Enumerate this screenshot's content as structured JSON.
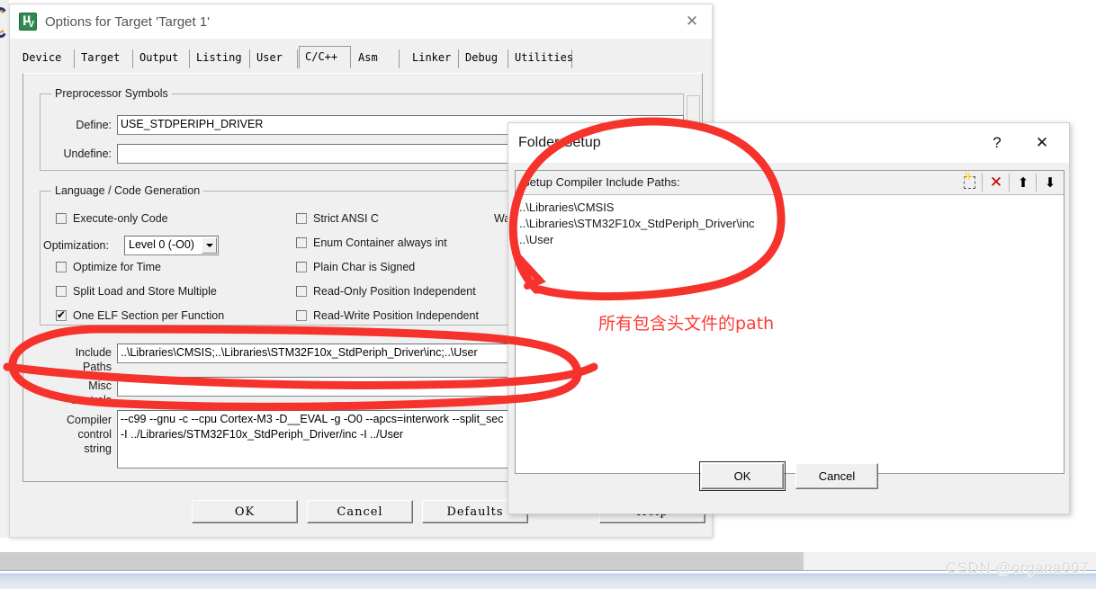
{
  "options_dialog": {
    "title": "Options for Target 'Target 1'",
    "icon": "keil-uvision-icon",
    "close_label": "✕",
    "tabs": [
      {
        "label": "Device",
        "active": false
      },
      {
        "label": "Target",
        "active": false
      },
      {
        "label": "Output",
        "active": false
      },
      {
        "label": "Listing",
        "active": false
      },
      {
        "label": "User",
        "active": false
      },
      {
        "label": "C/C++",
        "active": true
      },
      {
        "label": "Asm",
        "active": false
      },
      {
        "label": "Linker",
        "active": false
      },
      {
        "label": "Debug",
        "active": false
      },
      {
        "label": "Utilities",
        "active": false
      }
    ],
    "preprocessor": {
      "group_label": "Preprocessor Symbols",
      "define_label": "Define:",
      "define_value": "USE_STDPERIPH_DRIVER",
      "undefine_label": "Undefine:",
      "undefine_value": ""
    },
    "language": {
      "group_label": "Language / Code Generation",
      "left_checks": [
        {
          "label": "Execute-only Code",
          "checked": false
        },
        {
          "label": "Optimize for Time",
          "checked": false
        },
        {
          "label": "Split Load and Store Multiple",
          "checked": false
        },
        {
          "label": "One ELF Section per Function",
          "checked": true
        }
      ],
      "right_checks": [
        {
          "label": "Strict ANSI C",
          "checked": false
        },
        {
          "label": "Enum Container always int",
          "checked": false
        },
        {
          "label": "Plain Char is Signed",
          "checked": false
        },
        {
          "label": "Read-Only Position Independent",
          "checked": false
        },
        {
          "label": "Read-Write Position Independent",
          "checked": false
        }
      ],
      "optimization_label": "Optimization:",
      "optimization_value": "Level 0 (-O0)",
      "warnings_label_clipped": "Wa"
    },
    "paths": {
      "include_label_line1": "Include",
      "include_label_line2": "Paths",
      "include_value": "..\\Libraries\\CMSIS;..\\Libraries\\STM32F10x_StdPeriph_Driver\\inc;..\\User",
      "misc_label_line1": "Misc",
      "misc_label_line2": "Controls",
      "misc_value": "",
      "compiler_label_line1": "Compiler",
      "compiler_label_line2": "control",
      "compiler_label_line3": "string",
      "compiler_value": "--c99 --gnu -c --cpu Cortex-M3 -D__EVAL -g -O0 --apcs=interwork --split_sec\n-I ../Libraries/STM32F10x_StdPeriph_Driver/inc -I ../User"
    },
    "buttons": [
      {
        "label": "OK"
      },
      {
        "label": "Cancel"
      },
      {
        "label": "Defaults"
      },
      {
        "label": "Help"
      }
    ]
  },
  "folder_dialog": {
    "title": "Folder Setup",
    "help_label": "?",
    "close_label": "✕",
    "list_header": "Setup Compiler Include Paths:",
    "toolbar": [
      {
        "name": "new-path-icon",
        "tooltip": "New"
      },
      {
        "name": "delete-path-icon",
        "tooltip": "Delete"
      },
      {
        "name": "move-up-icon",
        "tooltip": "Move Up"
      },
      {
        "name": "move-down-icon",
        "tooltip": "Move Down"
      }
    ],
    "paths": [
      "..\\Libraries\\CMSIS",
      "..\\Libraries\\STM32F10x_StdPeriph_Driver\\inc",
      "..\\User"
    ],
    "ok_label": "OK",
    "cancel_label": "Cancel"
  },
  "annotations": {
    "note_text": "所有包含头文件的path",
    "color": "#fb3b34"
  },
  "watermark": {
    "text": "CSDN @organa007"
  }
}
